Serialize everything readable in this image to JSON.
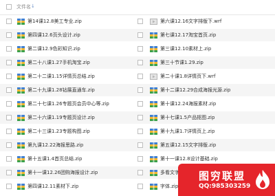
{
  "header": {
    "column_label": "文件名",
    "sort_icon": "sort-down-icon"
  },
  "file_icon_colors": {
    "zip_top": "#3f7fd0",
    "zip_mid": "#f2b630",
    "zip_bottom": "#3aa04a",
    "wrf": "#b5b5b5"
  },
  "rows": [
    {
      "left": {
        "name": "第14课12.8美工专业.zip",
        "icon": "zip-archive-icon"
      },
      "right": {
        "name": "第六课12.16文字排版下.wrf",
        "icon": "video-file-icon"
      }
    },
    {
      "left": {
        "name": "第四课12.6页头设计.zip",
        "icon": "zip-archive-icon"
      },
      "right": {
        "name": "第七课12.17淘宝首页.zip",
        "icon": "zip-archive-icon"
      }
    },
    {
      "left": {
        "name": "第二课12.9色彩知识.zip",
        "icon": "zip-archive-icon"
      },
      "right": {
        "name": "第三课12.10素材上.zip",
        "icon": "zip-archive-icon"
      }
    },
    {
      "left": {
        "name": "第二十八课1.27手机淘宝.zip",
        "icon": "zip-archive-icon"
      },
      "right": {
        "name": "第三十节课1.29.zip",
        "icon": "zip-archive-icon"
      }
    },
    {
      "left": {
        "name": "第二十二课1.15详情页总结.zip",
        "icon": "zip-archive-icon"
      },
      "right": {
        "name": "第二十课1.8详情页下.wrf",
        "icon": "video-file-icon"
      }
    },
    {
      "left": {
        "name": "第二十九课1.28钻展直通车.zip",
        "icon": "zip-archive-icon"
      },
      "right": {
        "name": "第十二课12.29合成海报光源.zip",
        "icon": "zip-archive-icon"
      }
    },
    {
      "left": {
        "name": "第二十七课1.26专题页会员中心等.zip",
        "icon": "zip-archive-icon"
      },
      "right": {
        "name": "第十课12.24海报素材.zip",
        "icon": "zip-archive-icon"
      }
    },
    {
      "left": {
        "name": "第二十六课1.19专题页设计.zip",
        "icon": "zip-archive-icon"
      },
      "right": {
        "name": "第十七课1.5产品抠图.zip",
        "icon": "zip-archive-icon"
      }
    },
    {
      "left": {
        "name": "第二十三课1.23专题构图.zip",
        "icon": "zip-archive-icon"
      },
      "right": {
        "name": "第十九课1.7详情页上.zip",
        "icon": "zip-archive-icon"
      }
    },
    {
      "left": {
        "name": "第九课12.22海报思路.zip",
        "icon": "zip-archive-icon"
      },
      "right": {
        "name": "第五课12.15文字排版.zip",
        "icon": "zip-archive-icon"
      }
    },
    {
      "left": {
        "name": "第十五课1.4首页总结.zip",
        "icon": "zip-archive-icon"
      },
      "right": {
        "name": "第十一课12.8设计基础.zip",
        "icon": "zip-archive-icon"
      }
    },
    {
      "left": {
        "name": "第十一课12.26团购海报设计.zip",
        "icon": "zip-archive-icon"
      },
      "right": {
        "name": "多看文字排版.zip",
        "icon": "zip-archive-icon"
      }
    },
    {
      "left": {
        "name": "第四课12.11素材下.zip",
        "icon": "zip-archive-icon"
      },
      "right": {
        "name": "字体.zip",
        "icon": "zip-archive-icon"
      }
    }
  ],
  "watermark": {
    "title": "图穷联盟",
    "qq": "QQ:985303259",
    "logo_icon": "flame-logo-icon",
    "color": "#e5252b"
  }
}
